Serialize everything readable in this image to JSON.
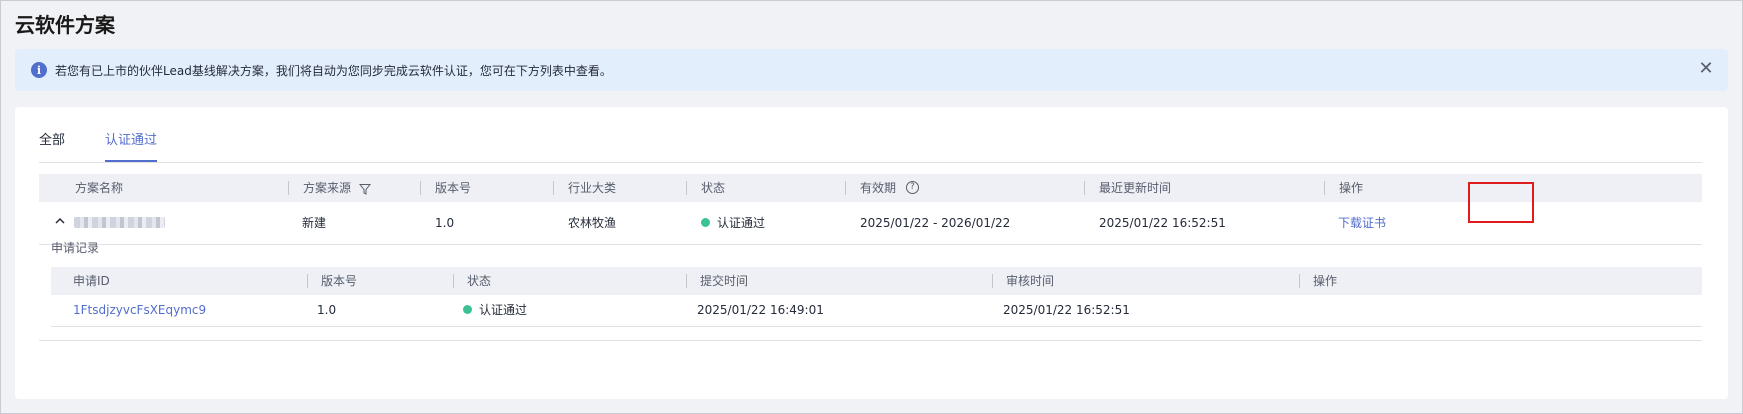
{
  "page": {
    "title": "云软件方案"
  },
  "notice": {
    "icon": "info-icon",
    "text": "若您有已上市的伙伴Lead基线解决方案，我们将自动为您同步完成云软件认证，您可在下方列表中查看。",
    "close_icon": "close-icon",
    "close_glyph": "✕"
  },
  "tabs": [
    {
      "label": "全部",
      "active": false
    },
    {
      "label": "认证通过",
      "active": true
    }
  ],
  "main_table": {
    "columns": [
      "方案名称",
      "方案来源",
      "版本号",
      "行业大类",
      "状态",
      "有效期",
      "最近更新时间",
      "操作"
    ],
    "rows": [
      {
        "name": "",
        "source": "新建",
        "version": "1.0",
        "industry": "农林牧渔",
        "status": "认证通过",
        "validity": "2025/01/22 - 2026/01/22",
        "updated": "2025/01/22 16:52:51",
        "action": "下载证书"
      }
    ]
  },
  "sub_section": {
    "label": "申请记录",
    "columns": [
      "申请ID",
      "版本号",
      "状态",
      "提交时间",
      "审核时间",
      "操作"
    ],
    "rows": [
      {
        "id": "1FtsdjzyvcFsXEqymc9",
        "version": "1.0",
        "status": "认证通过",
        "submitted": "2025/01/22 16:49:01",
        "reviewed": "2025/01/22 16:52:51",
        "action": ""
      }
    ]
  },
  "colors": {
    "accent": "#526ecc",
    "success": "#3ac295",
    "highlight": "#e01b1b",
    "notice_bg": "#e3eefc"
  }
}
